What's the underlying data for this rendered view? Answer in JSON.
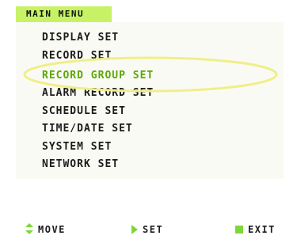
{
  "menu": {
    "title": "MAIN MENU",
    "items": [
      {
        "label": "DISPLAY SET",
        "selected": false
      },
      {
        "label": "RECORD SET",
        "selected": false
      },
      {
        "label": "RECORD GROUP SET",
        "selected": true
      },
      {
        "label": "ALARM RECORD SET",
        "selected": false
      },
      {
        "label": "SCHEDULE SET",
        "selected": false
      },
      {
        "label": "TIME/DATE SET",
        "selected": false
      },
      {
        "label": "SYSTEM SET",
        "selected": false
      },
      {
        "label": "NETWORK SET",
        "selected": false
      }
    ]
  },
  "footer": {
    "move": {
      "icon": "up-down-arrows-icon",
      "label": "MOVE"
    },
    "set": {
      "icon": "right-triangle-icon",
      "label": "SET"
    },
    "exit": {
      "icon": "green-square-icon",
      "label": "EXIT"
    }
  },
  "colors": {
    "title_background": "#c7f266",
    "selected_text": "#5aa800",
    "text": "#1b1b1b",
    "highlight_ellipse": "#efef8a",
    "icon_green": "#7fd63a"
  }
}
